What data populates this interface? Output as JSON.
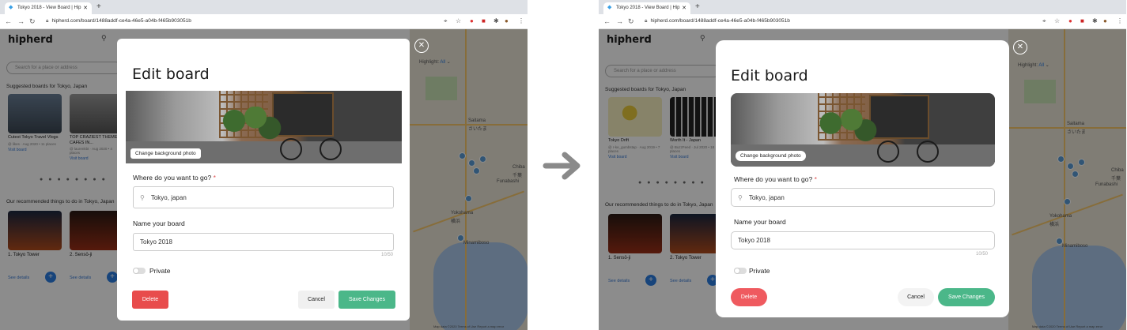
{
  "browser": {
    "tab_title": "Tokyo 2018 - View Board | Hip",
    "tab_close": "✕",
    "new_tab": "+",
    "url": "hipherd.com/board/1488addf-ce4a-46e5-a04b-f465b903051b"
  },
  "app": {
    "logo": "hipherd",
    "search_placeholder": "Search for a place or address",
    "suggested_title": "Suggested boards for Tokyo, Japan",
    "recommended_title": "Our recommended things to do in Tokyo, Japan",
    "highlight_label": "Highlight:",
    "highlight_value": "All",
    "map_labels": [
      "Saitama",
      "さいたま",
      "Funabashi",
      "Yokohama",
      "横浜",
      "Chiba",
      "千葉",
      "Kawasaki",
      "Minamiboso"
    ],
    "map_footer": "Map data ©2020  Terms of Use  Report a map error"
  },
  "left_app": {
    "boards": [
      {
        "title": "Cutest Tokyo Travel Vlogs",
        "meta": "@ likes · Aug 2020 • 11 places",
        "link": "Visit board"
      },
      {
        "title": "TOP CRAZIEST THEMED CAFES IN...",
        "meta": "@ laurenkbt · Aug 2020 • 4 places",
        "link": "Visit board"
      }
    ],
    "recs": [
      {
        "title": "1. Tokyo Tower",
        "link": "See details"
      },
      {
        "title": "2. Sensō-ji",
        "link": "See details"
      }
    ]
  },
  "right_app": {
    "boards": [
      {
        "title": "Tokyo Drift",
        "meta": "@ r-ke_gumbstap · Aug 2019 • 7 places",
        "link": "Visit board"
      },
      {
        "title": "Worth It - Japan",
        "meta": "@ BuzzFeed · Jul 2020 • 18 places",
        "link": "Visit board"
      }
    ],
    "recs": [
      {
        "title": "1. Sensō-ji",
        "link": "See details"
      },
      {
        "title": "2. Tokyo Tower",
        "link": "See details"
      }
    ]
  },
  "modal": {
    "title": "Edit board",
    "change_bg": "Change background photo",
    "where_label": "Where do you want to go?",
    "required_mark": "*",
    "destination": "Tokyo, japan",
    "name_label": "Name your board",
    "board_name": "Tokyo 2018",
    "char_count": "10/50",
    "private_label": "Private",
    "delete_label": "Delete",
    "cancel_label": "Cancel",
    "save_label": "Save Changes"
  },
  "colors": {
    "delete_left": "#e84c4c",
    "delete_right": "#ef5a5f",
    "save": "#4bb789",
    "accent_blue": "#2a7de1"
  }
}
